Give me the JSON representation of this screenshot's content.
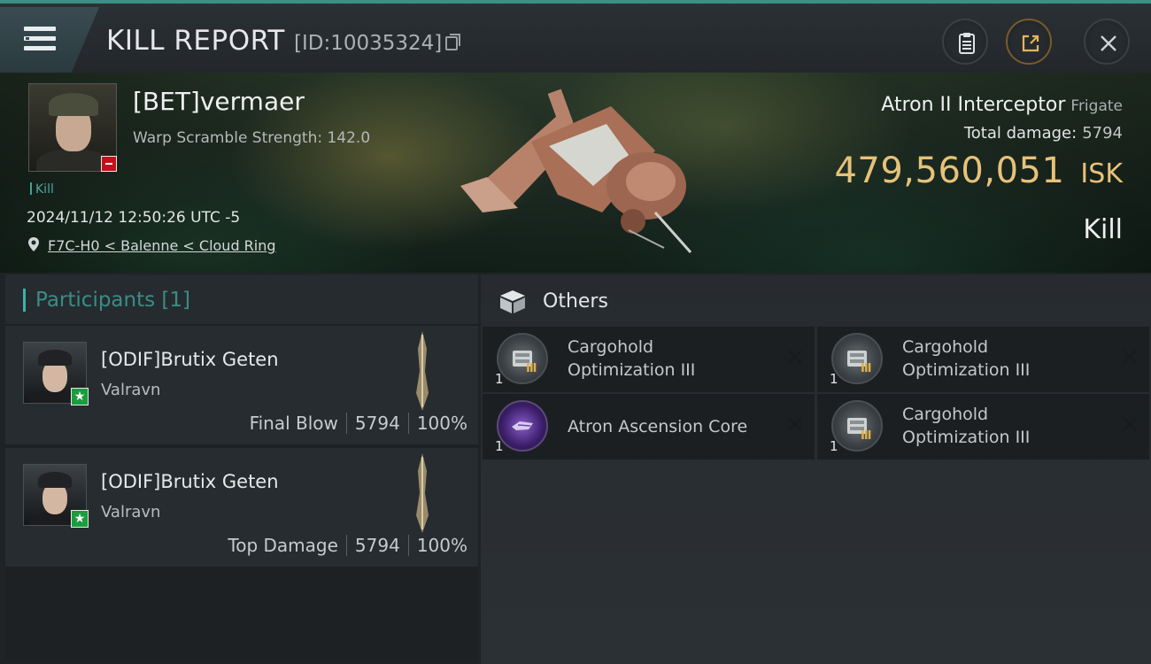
{
  "header": {
    "title": "KILL REPORT",
    "report_id": "[ID:10035324]"
  },
  "victim": {
    "name": "[BET]vermaer",
    "warp_scramble": "Warp Scramble Strength: 142.0",
    "kill_tag": "Kill",
    "datetime": "2024/11/12 12:50:26 UTC -5",
    "location": "F7C-H0 < Balenne < Cloud Ring",
    "ship_name": "Atron II Interceptor",
    "ship_class": "Frigate",
    "total_damage_label": "Total damage:",
    "total_damage": "5794",
    "isk_value": "479,560,051",
    "isk_unit": "ISK",
    "result": "Kill"
  },
  "participants": {
    "heading": "Participants [1]",
    "rows": [
      {
        "name": "[ODIF]Brutix Geten",
        "ship": "Valravn",
        "role": "Final Blow",
        "damage": "5794",
        "percent": "100%"
      },
      {
        "name": "[ODIF]Brutix Geten",
        "ship": "Valravn",
        "role": "Top Damage",
        "damage": "5794",
        "percent": "100%"
      }
    ]
  },
  "others": {
    "heading": "Others",
    "items": [
      {
        "line1": "Cargohold",
        "line2": "Optimization III",
        "qty": "1",
        "tier": "III"
      },
      {
        "line1": "Cargohold",
        "line2": "Optimization III",
        "qty": "1",
        "tier": "III"
      },
      {
        "line1": "Atron Ascension Core",
        "qty": "1"
      },
      {
        "line1": "Cargohold",
        "line2": "Optimization III",
        "qty": "1",
        "tier": "III"
      }
    ]
  },
  "colors": {
    "accent": "#3fb1a6",
    "isk_gold": "#e6c279",
    "negative_badge": "#c1121b",
    "ally_badge": "#1b9d3d"
  }
}
